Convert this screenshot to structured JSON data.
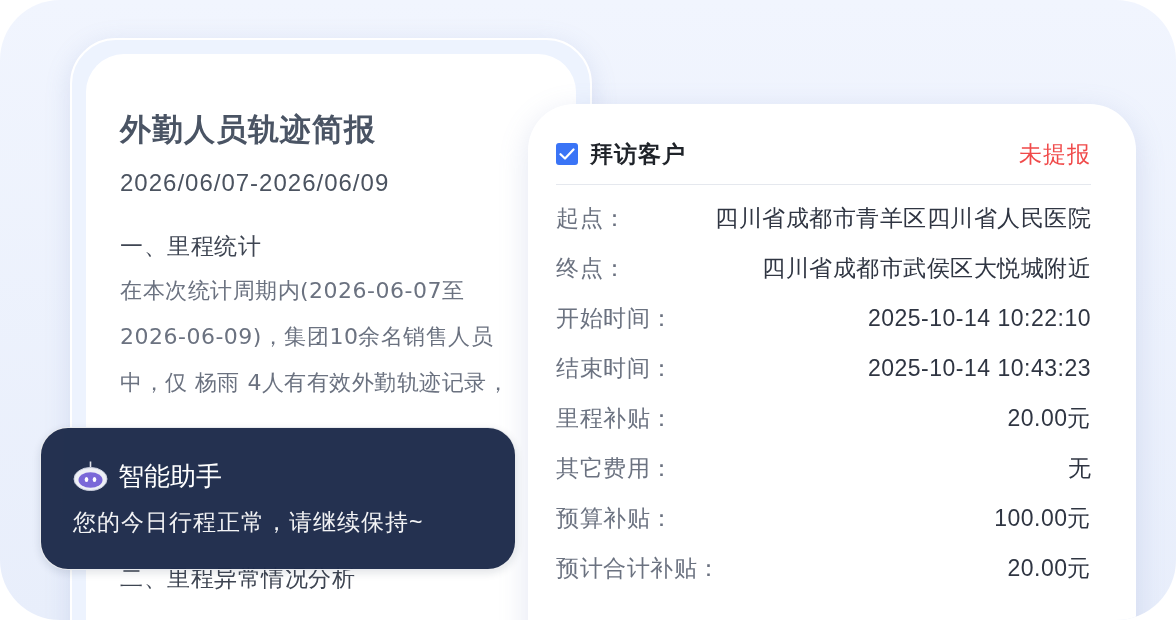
{
  "report_card": {
    "title": "外勤人员轨迹简报",
    "date_range": "2026/06/07-2026/06/09",
    "sections": [
      {
        "heading": "一、里程统计",
        "paragraph": "在本次统计周期内(2026-06-07至2026-06-09)，集团10余名销售人员中，仅 杨雨 4人有有效外勤轨迹记录，"
      },
      {
        "heading": "二、里程异常情况分析"
      }
    ]
  },
  "assistant_popup": {
    "title": "智能助手",
    "message": "您的今日行程正常，请继续保持~"
  },
  "visit_card": {
    "checkbox": {
      "label": "拜访客户",
      "checked": true
    },
    "status": "未提报",
    "fields": [
      {
        "label": "起点：",
        "value": "四川省成都市青羊区四川省人民医院"
      },
      {
        "label": "终点：",
        "value": "四川省成都市武侯区大悦城附近"
      },
      {
        "label": "开始时间：",
        "value": "2025-10-14 10:22:10"
      },
      {
        "label": "结束时间：",
        "value": "2025-10-14 10:43:23"
      },
      {
        "label": "里程补贴：",
        "value": "20.00元"
      },
      {
        "label": "其它费用：",
        "value": "无"
      },
      {
        "label": "预算补贴：",
        "value": "100.00元"
      },
      {
        "label": "预计合计补贴：",
        "value": "20.00元"
      }
    ]
  }
}
